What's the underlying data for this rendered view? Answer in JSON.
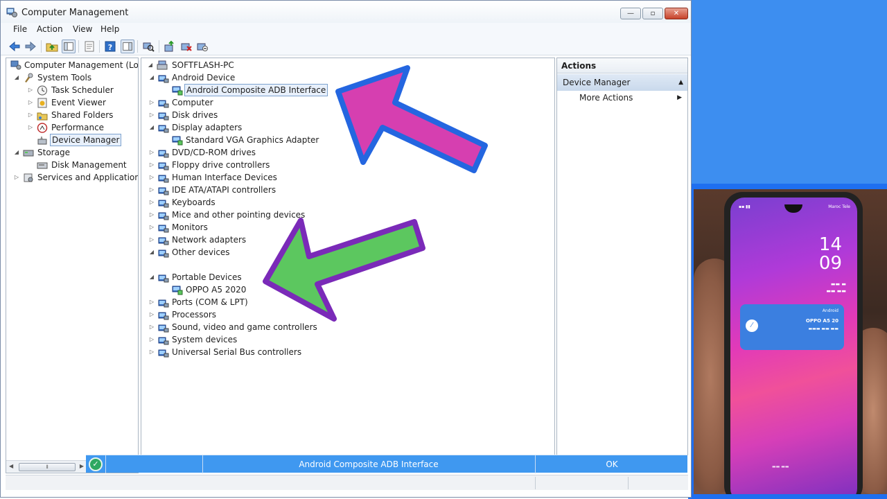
{
  "window": {
    "title": "Computer Management",
    "controls": {
      "minimize": "—",
      "maximize": "▫",
      "close": "✕"
    }
  },
  "menu": [
    "File",
    "Action",
    "View",
    "Help"
  ],
  "toolbar_icons": [
    "back-icon",
    "forward-icon",
    "up-folder-icon",
    "show-hide-tree-icon",
    "properties-icon",
    "help-icon",
    "show-action-pane-icon",
    "scan-hardware-icon",
    "update-driver-icon",
    "uninstall-icon",
    "disable-icon"
  ],
  "left_tree": {
    "root": "Computer Management (Local",
    "items": [
      {
        "label": "System Tools",
        "level": 1,
        "expander": "open"
      },
      {
        "label": "Task Scheduler",
        "level": 2,
        "expander": "closed"
      },
      {
        "label": "Event Viewer",
        "level": 2,
        "expander": "closed"
      },
      {
        "label": "Shared Folders",
        "level": 2,
        "expander": "closed"
      },
      {
        "label": "Performance",
        "level": 2,
        "expander": "closed"
      },
      {
        "label": "Device Manager",
        "level": 2,
        "expander": "none",
        "selected": true
      },
      {
        "label": "Storage",
        "level": 1,
        "expander": "open"
      },
      {
        "label": "Disk Management",
        "level": 2,
        "expander": "none"
      },
      {
        "label": "Services and Applications",
        "level": 1,
        "expander": "closed"
      }
    ]
  },
  "device_tree": {
    "root": "SOFTFLASH-PC",
    "items": [
      {
        "label": "Android Device",
        "level": 1,
        "expander": "open"
      },
      {
        "label": "Android Composite ADB Interface",
        "level": 2,
        "selected": true
      },
      {
        "label": "Computer",
        "level": 1,
        "expander": "closed"
      },
      {
        "label": "Disk drives",
        "level": 1,
        "expander": "closed"
      },
      {
        "label": "Display adapters",
        "level": 1,
        "expander": "open"
      },
      {
        "label": "Standard VGA Graphics Adapter",
        "level": 2
      },
      {
        "label": "DVD/CD-ROM drives",
        "level": 1,
        "expander": "closed"
      },
      {
        "label": "Floppy drive controllers",
        "level": 1,
        "expander": "closed"
      },
      {
        "label": "Human Interface Devices",
        "level": 1,
        "expander": "closed"
      },
      {
        "label": "IDE ATA/ATAPI controllers",
        "level": 1,
        "expander": "closed"
      },
      {
        "label": "Keyboards",
        "level": 1,
        "expander": "closed"
      },
      {
        "label": "Mice and other pointing devices",
        "level": 1,
        "expander": "closed"
      },
      {
        "label": "Monitors",
        "level": 1,
        "expander": "closed"
      },
      {
        "label": "Network adapters",
        "level": 1,
        "expander": "closed"
      },
      {
        "label": "Other devices",
        "level": 1,
        "expander": "open"
      },
      {
        "label": "",
        "level": 2
      },
      {
        "label": "Portable Devices",
        "level": 1,
        "expander": "open"
      },
      {
        "label": "OPPO A5 2020",
        "level": 2
      },
      {
        "label": "Ports (COM & LPT)",
        "level": 1,
        "expander": "closed"
      },
      {
        "label": "Processors",
        "level": 1,
        "expander": "closed"
      },
      {
        "label": "Sound, video and game controllers",
        "level": 1,
        "expander": "closed"
      },
      {
        "label": "System devices",
        "level": 1,
        "expander": "closed"
      },
      {
        "label": "Universal Serial Bus controllers",
        "level": 1,
        "expander": "closed"
      }
    ]
  },
  "actions": {
    "header": "Actions",
    "section": "Device Manager",
    "more": "More Actions"
  },
  "status_overlay": {
    "device": "Android Composite ADB Interface",
    "ok": "OK"
  },
  "phone": {
    "carrier": "Maroc Tele",
    "clock_hour": "14",
    "clock_min": "09",
    "notif_app": "Android",
    "notif_title": "OPPO A5 20",
    "notif_check": "✓"
  },
  "colors": {
    "pink_arrow": "#d63fb0",
    "pink_arrow_border": "#2466e0",
    "green_arrow": "#5cc75f",
    "green_arrow_border": "#7a2ab8",
    "status_blue": "#3f98f0",
    "background_blue": "#3d8ef0"
  }
}
